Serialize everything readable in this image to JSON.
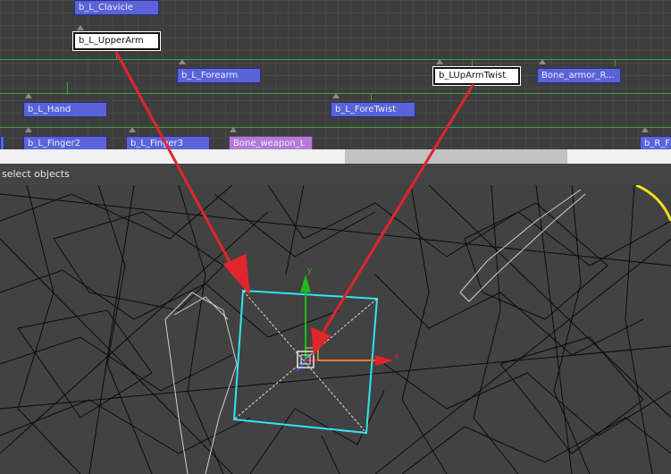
{
  "schematic": {
    "nodes": {
      "clavicle": "b_L_Clavicle",
      "upperarm": "b_L_UpperArm",
      "forearm": "b_L_Forearm",
      "uparmtwist": "b_LUpArmTwist",
      "bone_armor": "Bone_armor_R...",
      "hand": "b_L_Hand",
      "foretwist": "b_L_ForeTwist",
      "finger2": "b_L_Finger2",
      "finger3": "b_L_Finger3",
      "bone_weapon": "Bone_weapon_L",
      "r_partial": "b_R_F"
    }
  },
  "status": {
    "text": "select objects"
  },
  "viewport": {
    "gizmo": {
      "x_label": "x",
      "y_label": "y"
    },
    "colors": {
      "selection": "#2fe6f0",
      "gizmo_x": "#e8202a",
      "gizmo_y": "#1fb81f",
      "gizmo_z": "#2d5bff",
      "arrow": "#e0262c"
    }
  }
}
